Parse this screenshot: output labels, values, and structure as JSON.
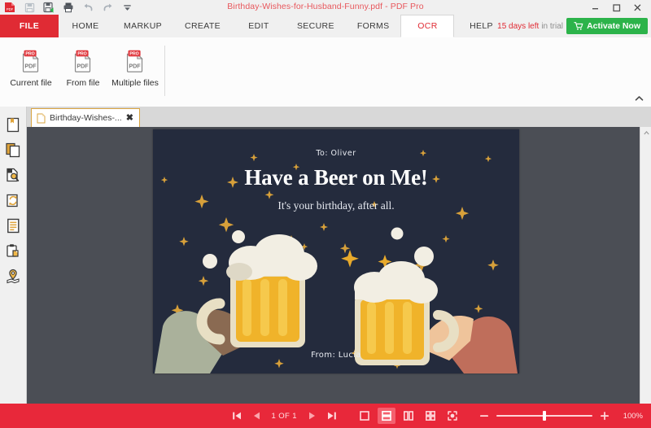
{
  "window": {
    "title": "Birthday-Wishes-for-Husband-Funny.pdf - PDF Pro",
    "minimize_label": "Minimize",
    "maximize_label": "Maximize",
    "close_label": "Close"
  },
  "quick_access": {
    "items": [
      {
        "name": "pdf-logo-icon",
        "label": "PDF Pro"
      },
      {
        "name": "save-icon",
        "label": "Save"
      },
      {
        "name": "save-as-icon",
        "label": "Save As"
      },
      {
        "name": "print-icon",
        "label": "Print"
      },
      {
        "name": "undo-icon",
        "label": "Undo"
      },
      {
        "name": "redo-icon",
        "label": "Redo"
      },
      {
        "name": "customize-toolbar-icon",
        "label": "Customize Quick Access Toolbar"
      }
    ]
  },
  "ribbon": {
    "file_tab": "FILE",
    "tabs": [
      {
        "label": "HOME",
        "active": false
      },
      {
        "label": "MARKUP",
        "active": false
      },
      {
        "label": "CREATE",
        "active": false
      },
      {
        "label": "EDIT",
        "active": false
      },
      {
        "label": "SECURE",
        "active": false
      },
      {
        "label": "FORMS",
        "active": false
      },
      {
        "label": "OCR",
        "active": true
      },
      {
        "label": "HELP",
        "active": false
      }
    ],
    "trial": {
      "days": "15 days left",
      "suffix": "in trial",
      "activate_label": "Activate Now"
    },
    "ocr_buttons": [
      {
        "label": "Current file",
        "badge": "PRO",
        "glyph": "PDF"
      },
      {
        "label": "From file",
        "badge": "PRO",
        "glyph": "PDF"
      },
      {
        "label": "Multiple files",
        "badge": "PRO",
        "glyph": "PDF"
      }
    ],
    "collapse_label": "Collapse Ribbon"
  },
  "doc_tabs": [
    {
      "label": "Birthday-Wishes-...",
      "close": "✖"
    }
  ],
  "sidebar": {
    "items": [
      {
        "name": "bookmarks-icon",
        "label": "Bookmarks"
      },
      {
        "name": "page-thumbnails-icon",
        "label": "Page Thumbnails"
      },
      {
        "name": "search-icon",
        "label": "Search"
      },
      {
        "name": "rotate-pages-icon",
        "label": "Rotate Pages"
      },
      {
        "name": "layers-icon",
        "label": "Layers"
      },
      {
        "name": "attachments-icon",
        "label": "Attachments"
      },
      {
        "name": "destinations-icon",
        "label": "Destinations"
      }
    ]
  },
  "document": {
    "card": {
      "to": "To: Oliver",
      "title": "Have a Beer on Me!",
      "subtitle": "It's your birthday, after all.",
      "from": "From: Lucia"
    },
    "colors": {
      "background": "#242b3d",
      "star": "#d7a03a",
      "beer": "#f0b32a",
      "beer_light": "#f7cd52",
      "foam": "#f2eee3",
      "mug_outline": "#e8dfc4",
      "hand_left": "#8a6a52",
      "hand_right": "#efc49b",
      "sleeve_left": "#aab19b",
      "sleeve_right": "#bf6e5b"
    }
  },
  "statusbar": {
    "first_page_label": "First Page",
    "prev_page_label": "Previous Page",
    "page_indicator": "1 OF 1",
    "next_page_label": "Next Page",
    "last_page_label": "Last Page",
    "view_modes": [
      {
        "name": "single-page-view-icon",
        "label": "Single Page",
        "active": false
      },
      {
        "name": "continuous-view-icon",
        "label": "Continuous",
        "active": true
      },
      {
        "name": "two-page-view-icon",
        "label": "Two Pages",
        "active": false
      },
      {
        "name": "grid-view-icon",
        "label": "Grid View",
        "active": false
      },
      {
        "name": "fit-page-icon",
        "label": "Fit Page",
        "active": false
      }
    ],
    "zoom_out_label": "Zoom Out",
    "zoom_in_label": "Zoom In",
    "zoom_level": "100%"
  },
  "theme": {
    "accent_red": "#e02b34",
    "status_red": "#e8283a",
    "green": "#2cb34a",
    "workspace": "#4b4e55",
    "tab_gold": "#d9a441"
  }
}
